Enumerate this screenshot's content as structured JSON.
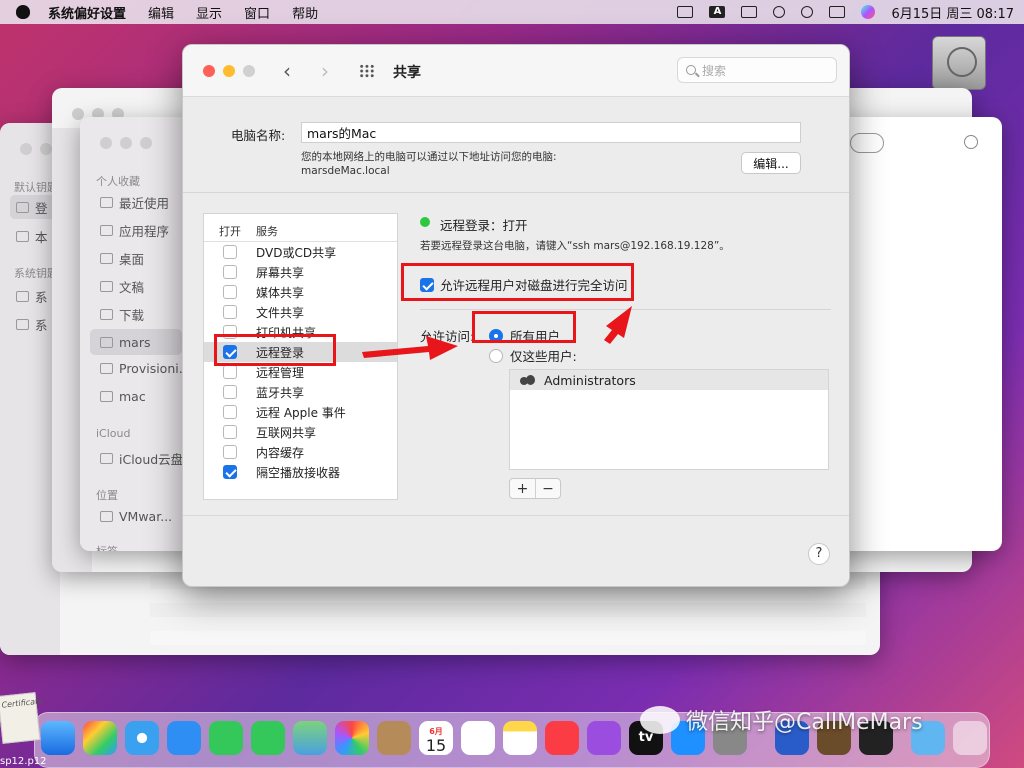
{
  "menubar": {
    "app_name": "系统偏好设置",
    "menus": [
      "编辑",
      "显示",
      "窗口",
      "帮助"
    ],
    "status_a": "A",
    "clock": "6月15日 周三 08:17"
  },
  "finder_back": {
    "sec_keychain": "默认钥匙",
    "item_login": "登",
    "item_local": "本",
    "sec_system": "系统钥匙",
    "item_sys1": "系",
    "item_sys2": "系"
  },
  "finder_front": {
    "sec_favorites": "个人收藏",
    "items": [
      {
        "label": "最近使用",
        "icon": "clock-icon"
      },
      {
        "label": "应用程序",
        "icon": "apps-icon"
      },
      {
        "label": "桌面",
        "icon": "desktop-icon"
      },
      {
        "label": "文稿",
        "icon": "document-icon"
      },
      {
        "label": "下载",
        "icon": "download-icon"
      },
      {
        "label": "mars",
        "icon": "home-icon"
      },
      {
        "label": "Provisioni...",
        "icon": "folder-icon"
      },
      {
        "label": "mac",
        "icon": "drive-icon"
      }
    ],
    "sec_icloud": "iCloud",
    "icloud_item": "iCloud云盘",
    "sec_location": "位置",
    "location_item": "VMwar...",
    "sec_tags": "标签"
  },
  "window": {
    "title": "共享",
    "search_placeholder": "搜索",
    "computer_name_label": "电脑名称:",
    "computer_name_value": "mars的Mac",
    "network_desc_1": "您的本地网络上的电脑可以通过以下地址访问您的电脑:",
    "network_desc_2": "marsdeMac.local",
    "edit_button": "编辑...",
    "col_on": "打开",
    "col_service": "服务",
    "services": [
      {
        "label": "DVD或CD共享",
        "checked": false
      },
      {
        "label": "屏幕共享",
        "checked": false
      },
      {
        "label": "媒体共享",
        "checked": false
      },
      {
        "label": "文件共享",
        "checked": false
      },
      {
        "label": "打印机共享",
        "checked": false
      },
      {
        "label": "远程登录",
        "checked": true
      },
      {
        "label": "远程管理",
        "checked": false
      },
      {
        "label": "蓝牙共享",
        "checked": false
      },
      {
        "label": "远程 Apple 事件",
        "checked": false
      },
      {
        "label": "互联网共享",
        "checked": false
      },
      {
        "label": "内容缓存",
        "checked": false
      },
      {
        "label": "隔空播放接收器",
        "checked": true
      }
    ],
    "status_text": "远程登录：打开",
    "hint_text": "若要远程登录这台电脑，请键入“ssh mars@192.168.19.128”。",
    "full_access_label": "允许远程用户对磁盘进行完全访问",
    "allow_access_label": "允许访问:",
    "radio_all": "所有用户",
    "radio_only": "仅这些用户:",
    "users": [
      "Administrators"
    ],
    "add_label": "+",
    "remove_label": "−",
    "help_label": "?"
  },
  "colors": {
    "accent": "#1a73e8",
    "status_on": "#2ec840",
    "annotation_red": "#e8151b"
  },
  "dock": {
    "calendar_month": "6月",
    "calendar_day": "15",
    "tv_label": "tv"
  },
  "watermark": "微信知乎@CallMeMars",
  "desktop": {
    "cert_text": "Certificate",
    "file_label": "sp12.p12"
  }
}
